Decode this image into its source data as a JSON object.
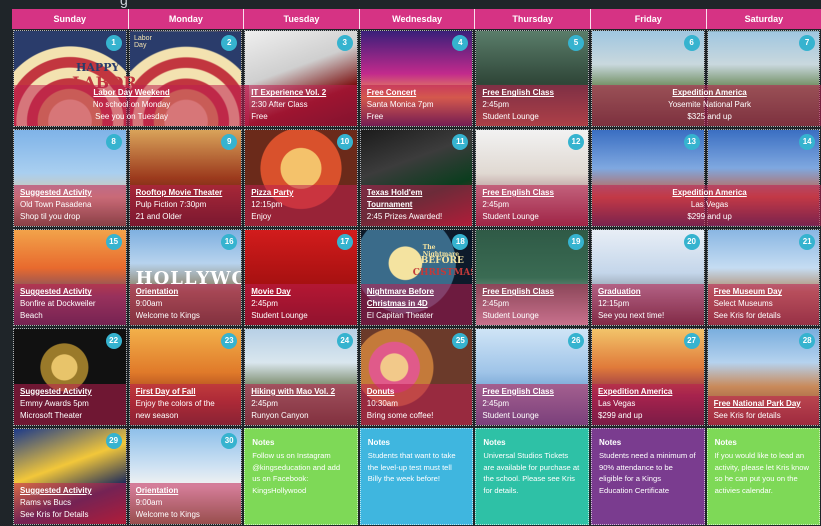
{
  "header_fragment": "g",
  "days": [
    "Sunday",
    "Monday",
    "Tuesday",
    "Wednesday",
    "Thursday",
    "Friday",
    "Saturday"
  ],
  "cells": [
    {
      "n": "1",
      "img": "labor-day-image",
      "title": "Labor Day Weekend",
      "l1": "No school on Monday",
      "l2": "See you on Tuesday",
      "center": true,
      "art_text": [
        "HAPPY",
        "LABOR",
        "Labor Day"
      ]
    },
    {
      "n": "2",
      "img": "",
      "title": "",
      "l1": "",
      "l2": ""
    },
    {
      "n": "3",
      "img": "it-clown-image",
      "title": "IT Experience Vol. 2",
      "l1": "2:30 After Class",
      "l2": "Free"
    },
    {
      "n": "4",
      "img": "concert-pier-image",
      "title": "Free Concert",
      "l1": "Santa Monica 7pm",
      "l2": "Free"
    },
    {
      "n": "5",
      "img": "english-class-image",
      "title": "Free English Class",
      "l1": "2:45pm",
      "l2": "Student Lounge"
    },
    {
      "n": "6",
      "img": "yosemite-image",
      "title": "Expedition America",
      "l1": "Yosemite National Park",
      "l2": "$325 and up",
      "center": true
    },
    {
      "n": "7",
      "img": "",
      "title": "",
      "l1": "",
      "l2": ""
    },
    {
      "n": "8",
      "img": "pasadena-image",
      "title": "Suggested Activity",
      "l1": "Old Town Pasadena",
      "l2": "Shop til you drop"
    },
    {
      "n": "9",
      "img": "pulp-fiction-image",
      "title": "Rooftop Movie Theater",
      "l1": "Pulp Fiction 7:30pm",
      "l2": "21 and Older"
    },
    {
      "n": "10",
      "img": "pizza-image",
      "title": "Pizza Party",
      "l1": "12:15pm",
      "l2": "Enjoy"
    },
    {
      "n": "11",
      "img": "poker-image",
      "title": "Texas Hold'em Tournament",
      "l1": "2:45 Prizes Awarded!",
      "l2": ""
    },
    {
      "n": "12",
      "img": "teacher-image",
      "title": "Free English Class",
      "l1": "2:45pm",
      "l2": "Student Lounge"
    },
    {
      "n": "13",
      "img": "las-vegas-image",
      "title": "Expedition America",
      "l1": "Las Vegas",
      "l2": "$299 and up",
      "center": true
    },
    {
      "n": "14",
      "img": "",
      "title": "",
      "l1": "",
      "l2": ""
    },
    {
      "n": "15",
      "img": "sunset-beach-image",
      "title": "Suggested Activity",
      "l1": "Bonfire at Dockweiler Beach",
      "l2": ""
    },
    {
      "n": "16",
      "img": "hollywood-sign-image",
      "title": "Orientation",
      "l1": "9:00am",
      "l2": "Welcome to Kings",
      "art_text": [
        "HOLLYWOOD"
      ]
    },
    {
      "n": "17",
      "img": "popcorn-image",
      "title": "Movie Day",
      "l1": "2:45pm",
      "l2": "Student Lounge"
    },
    {
      "n": "18",
      "img": "nightmare-image",
      "title": "Nightmare Before Christmas in 4D",
      "l1": "El Capitan Theater",
      "l2": "",
      "art_text": [
        "The Nightmare",
        "BEFORE",
        "CHRISTMAS"
      ]
    },
    {
      "n": "19",
      "img": "teacher-board-image",
      "title": "Free English Class",
      "l1": "2:45pm",
      "l2": "Student Lounge"
    },
    {
      "n": "20",
      "img": "graduation-image",
      "title": "Graduation",
      "l1": "12:15pm",
      "l2": "See you next time!"
    },
    {
      "n": "21",
      "img": "museum-image",
      "title": "Free Museum Day",
      "l1": "Select Museums",
      "l2": "See Kris for details"
    },
    {
      "n": "22",
      "img": "emmy-image",
      "title": "Suggested Activity",
      "l1": "Emmy Awards 5pm",
      "l2": "Microsoft Theater"
    },
    {
      "n": "23",
      "img": "fall-image",
      "title": "First Day of Fall",
      "l1": "Enjoy the colors of the",
      "l2": "new season"
    },
    {
      "n": "24",
      "img": "hiking-image",
      "title": "Hiking with Mao Vol. 2",
      "l1": "2:45pm",
      "l2": "Runyon Canyon"
    },
    {
      "n": "25",
      "img": "donuts-image",
      "title": "Donuts",
      "l1": "10:30am",
      "l2": "Bring some coffee!"
    },
    {
      "n": "26",
      "img": "class-man-image",
      "title": "Free English Class",
      "l1": "2:45pm",
      "l2": "Student Lounge"
    },
    {
      "n": "27",
      "img": "las-vegas-strip-image",
      "title": "Expedition America",
      "l1": "Las Vegas",
      "l2": "$299 and up"
    },
    {
      "n": "28",
      "img": "canyon-image",
      "title": "Free National Park Day",
      "l1": "See Kris for details",
      "l2": ""
    },
    {
      "n": "29",
      "img": "football-image",
      "title": "Suggested Activity",
      "l1": "Rams vs Bucs",
      "l2": "See Kris for Details"
    },
    {
      "n": "30",
      "img": "campus-image",
      "title": "Orientation",
      "l1": "9:00am",
      "l2": "Welcome to Kings"
    }
  ],
  "notes": [
    {
      "h": "Notes",
      "body": "Follow us on Instagram @kingseducation and add us on Facebook: KingsHollywood",
      "color": "#7ed957"
    },
    {
      "h": "Notes",
      "body": "Students that want to take the level-up test must tell Billy the week before!",
      "color": "#3fb6df"
    },
    {
      "h": "Notes",
      "body": "Universal Studios Tickets are available for purchase at the school. Please see Kris for details.",
      "color": "#2ec1a6"
    },
    {
      "h": "Notes",
      "body": "Students need a minimum of 90% attendance to be eligible for a Kings Education Certificate",
      "color": "#7a3c8f"
    },
    {
      "h": "Notes",
      "body": "If you would like to lead an activity, please let Kris know so he can put you on the activies calendar.",
      "color": "#7ed957"
    }
  ],
  "colors": {
    "header_pink": "#d63384",
    "badge_blue": "#36b3cf",
    "overlay": "#be1e50"
  }
}
